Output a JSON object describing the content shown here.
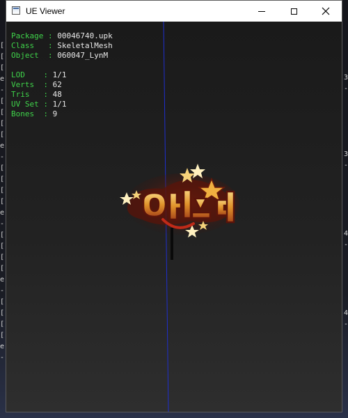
{
  "window": {
    "title": "UE Viewer"
  },
  "info": {
    "package_key": "Package",
    "package_value": "00046740.upk",
    "class_key": "Class",
    "class_value": "SkeletalMesh",
    "object_key": "Object",
    "object_value": "060047_LynM",
    "lod_key": "LOD",
    "lod_value": "1/1",
    "verts_key": "Verts",
    "verts_value": "62",
    "tris_key": "Tris",
    "tris_value": "48",
    "uvset_key": "UV Set",
    "uvset_value": "1/1",
    "bones_key": "Bones",
    "bones_value": "9"
  },
  "colors": {
    "key_text": "#3fd24a",
    "value_text": "#e8e8e8",
    "axis_line": "#1f2fd0",
    "viewport_bg": "#1f1f1f",
    "logo_gold": "#e8a030",
    "logo_red": "#7a1a10"
  },
  "icons": {
    "app": "ue-viewer-app-icon",
    "minimize": "minimize-icon",
    "maximize": "maximize-icon",
    "close": "close-icon",
    "mesh": "korean-title-logo-mesh"
  }
}
